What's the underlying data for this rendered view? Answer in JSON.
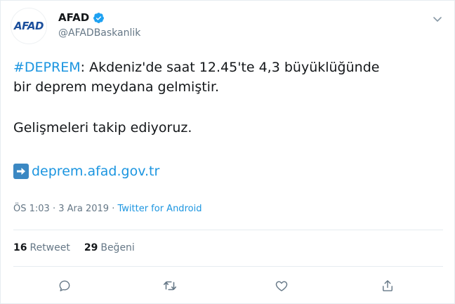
{
  "account": {
    "name": "AFAD",
    "handle": "@AFADBaskanlik",
    "avatar_text_main": "AFAD",
    "verified": true,
    "brand_blue": "#1c4f9c",
    "brand_red": "#e3251f"
  },
  "tweet": {
    "hashtag": "#DEPREM",
    "text_line1_rest": ": Akdeniz'de saat 12.45'te 4,3 büyüklüğünde",
    "text_line2": "bir deprem meydana gelmiştir.",
    "text_line3": "Gelişmeleri takip ediyoruz.",
    "link_icon": "arrow-right-icon",
    "link_text": "deprem.afad.gov.tr"
  },
  "meta": {
    "time": "ÖS 1:03",
    "date": "3 Ara 2019",
    "separator": "·",
    "source": "Twitter for Android"
  },
  "stats": {
    "retweets_count": "16",
    "retweets_label": "Retweet",
    "likes_count": "29",
    "likes_label": "Beğeni"
  },
  "actions": [
    "reply-icon",
    "retweet-icon",
    "like-icon",
    "share-icon"
  ],
  "colors": {
    "link": "#1b95e0",
    "muted": "#657786",
    "text": "#14171a",
    "border": "#e6ecf0"
  }
}
